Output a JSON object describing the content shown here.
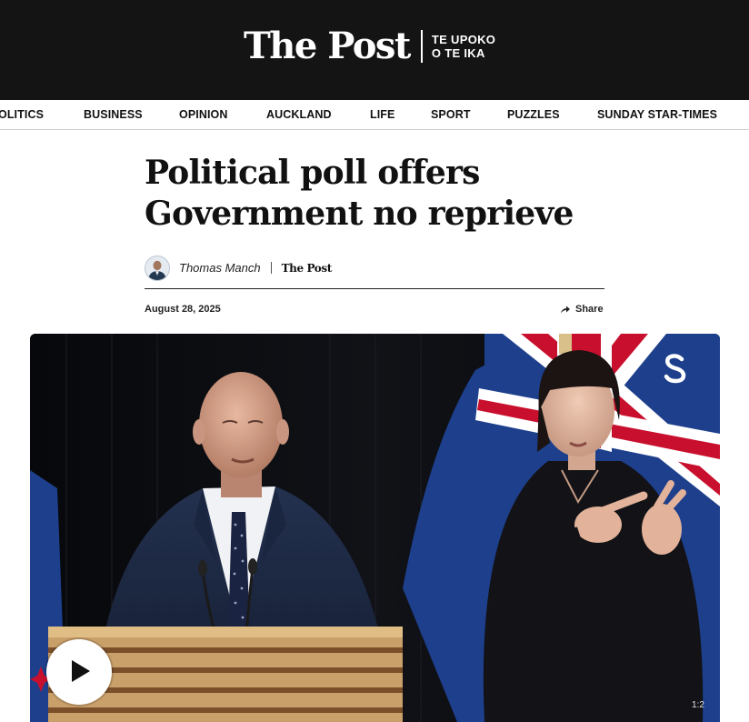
{
  "masthead": {
    "logo": "The Post",
    "tagline_line1": "TE UPOKO",
    "tagline_line2": "O TE IKA",
    "background": "#141414"
  },
  "nav": {
    "items": [
      {
        "label": "OLITICS"
      },
      {
        "label": "BUSINESS"
      },
      {
        "label": "OPINION"
      },
      {
        "label": "AUCKLAND"
      },
      {
        "label": "LIFE"
      },
      {
        "label": "SPORT"
      },
      {
        "label": "PUZZLES"
      },
      {
        "label": "SUNDAY STAR-TIMES"
      }
    ]
  },
  "article": {
    "headline": "Political poll offers Government no reprieve",
    "author": "Thomas Manch",
    "publication": "The Post",
    "date": "August 28, 2025",
    "share_label": "Share"
  },
  "video": {
    "play_icon": "play-icon",
    "brand_icon": "stuff-s-logo-icon",
    "duration_partial": "1:2",
    "colors": {
      "flag_blue": "#1d3f8c",
      "flag_red": "#c8102e",
      "lectern_wood": "#c9a06a"
    }
  }
}
